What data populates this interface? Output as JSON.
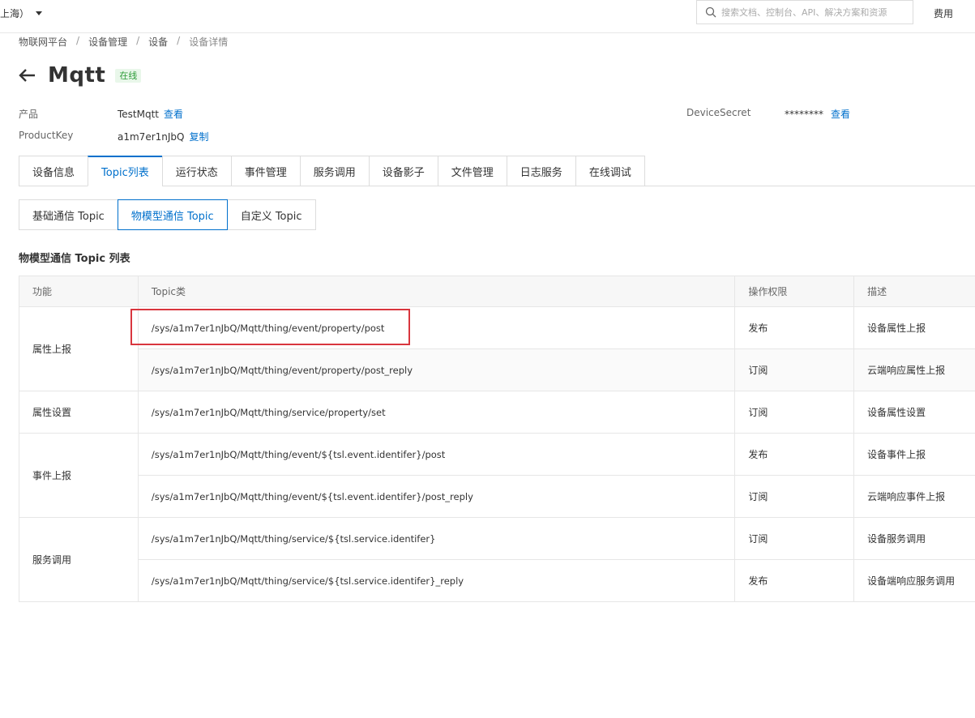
{
  "topbar": {
    "region": "上海）",
    "search_placeholder": "搜索文档、控制台、API、解决方案和资源",
    "fee": "费用"
  },
  "breadcrumb": [
    "物联网平台",
    "设备管理",
    "设备",
    "设备详情"
  ],
  "header": {
    "title": "Mqtt",
    "status": "在线"
  },
  "meta": {
    "product_label": "产品",
    "product_value": "TestMqtt",
    "product_link": "查看",
    "productkey_label": "ProductKey",
    "productkey_value": "a1m7er1nJbQ",
    "productkey_link": "复制",
    "secret_label": "DeviceSecret",
    "secret_value": "********",
    "secret_link": "查看"
  },
  "tabs": [
    "设备信息",
    "Topic列表",
    "运行状态",
    "事件管理",
    "服务调用",
    "设备影子",
    "文件管理",
    "日志服务",
    "在线调试"
  ],
  "active_tab": 1,
  "subtabs": [
    "基础通信 Topic",
    "物模型通信 Topic",
    "自定义 Topic"
  ],
  "active_subtab": 1,
  "section_title": "物模型通信 Topic 列表",
  "table": {
    "headers": [
      "功能",
      "Topic类",
      "操作权限",
      "描述"
    ],
    "groups": [
      {
        "function": "属性上报",
        "rows": [
          {
            "topic": "/sys/a1m7er1nJbQ/Mqtt/thing/event/property/post",
            "perm": "发布",
            "desc": "设备属性上报"
          },
          {
            "topic": "/sys/a1m7er1nJbQ/Mqtt/thing/event/property/post_reply",
            "perm": "订阅",
            "desc": "云端响应属性上报"
          }
        ]
      },
      {
        "function": "属性设置",
        "rows": [
          {
            "topic": "/sys/a1m7er1nJbQ/Mqtt/thing/service/property/set",
            "perm": "订阅",
            "desc": "设备属性设置"
          }
        ]
      },
      {
        "function": "事件上报",
        "rows": [
          {
            "topic": "/sys/a1m7er1nJbQ/Mqtt/thing/event/${tsl.event.identifer}/post",
            "perm": "发布",
            "desc": "设备事件上报"
          },
          {
            "topic": "/sys/a1m7er1nJbQ/Mqtt/thing/event/${tsl.event.identifer}/post_reply",
            "perm": "订阅",
            "desc": "云端响应事件上报"
          }
        ]
      },
      {
        "function": "服务调用",
        "rows": [
          {
            "topic": "/sys/a1m7er1nJbQ/Mqtt/thing/service/${tsl.service.identifer}",
            "perm": "订阅",
            "desc": "设备服务调用"
          },
          {
            "topic": "/sys/a1m7er1nJbQ/Mqtt/thing/service/${tsl.service.identifer}_reply",
            "perm": "发布",
            "desc": "设备端响应服务调用"
          }
        ]
      }
    ]
  },
  "colors": {
    "accent": "#0070cc",
    "status_bg": "#e9f7ea",
    "status_text": "#2e9c3a",
    "highlight": "#d9363e"
  }
}
